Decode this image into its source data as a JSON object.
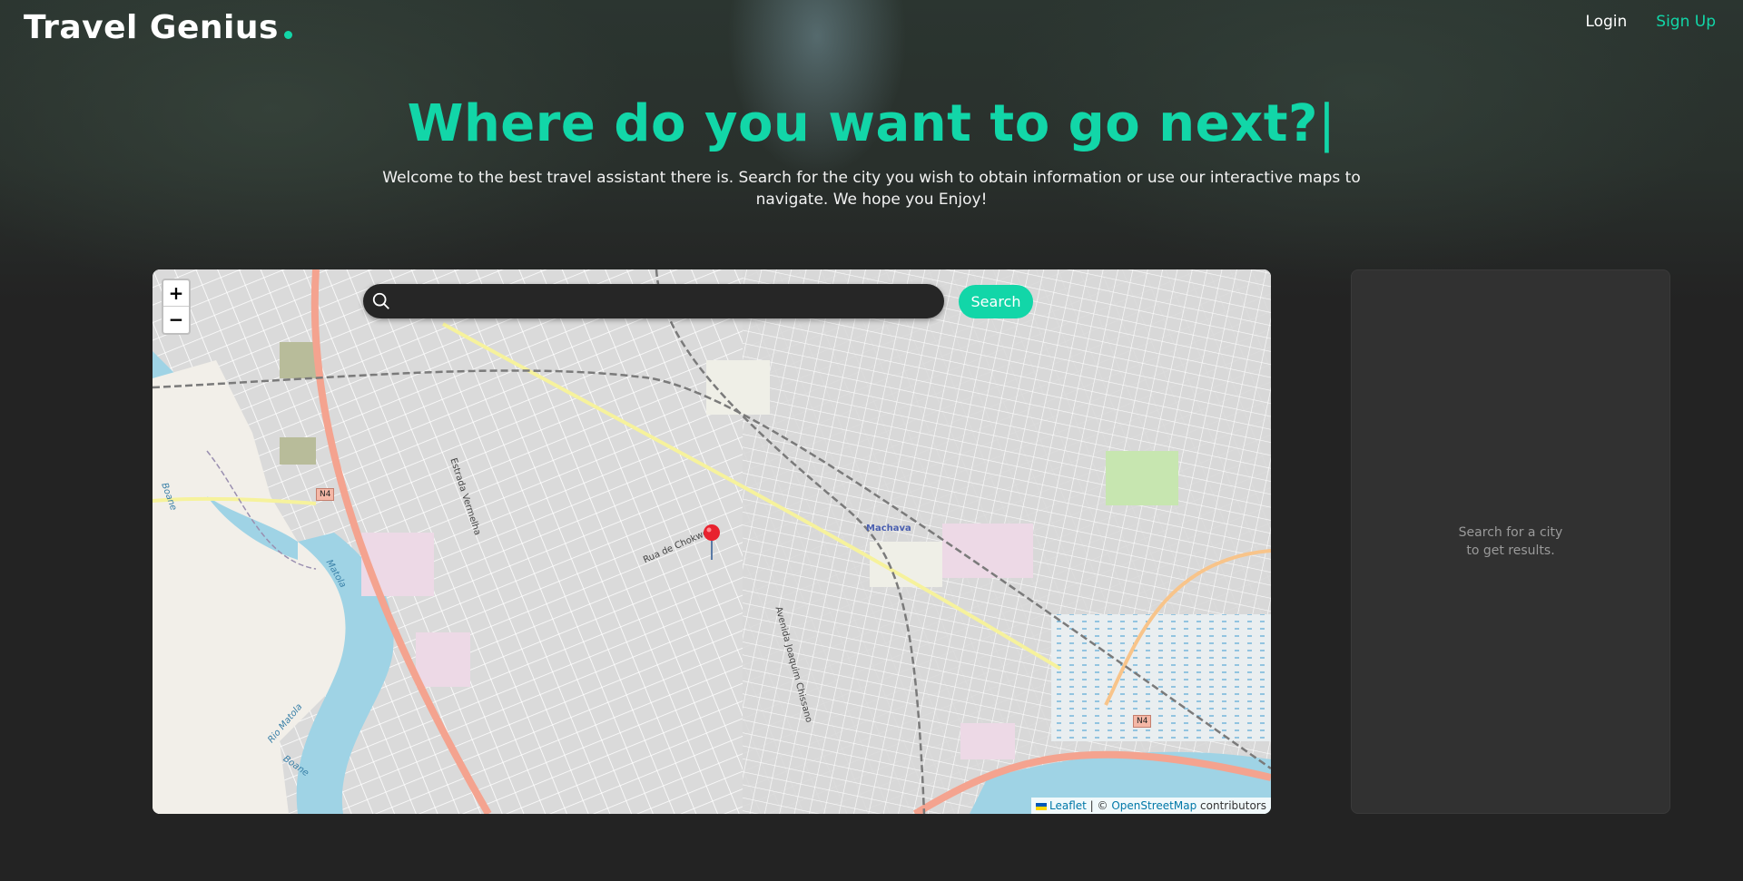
{
  "header": {
    "brand": "Travel Genius",
    "login_label": "Login",
    "signup_label": "Sign Up",
    "accent_color": "#12d6a8"
  },
  "hero": {
    "headline": "Where do you want to go next?",
    "cursor": "|",
    "subtitle": "Welcome to the best travel assistant there is. Search for the city you wish to obtain information or use our interactive maps to navigate. We hope you Enjoy!"
  },
  "map": {
    "zoom_in_label": "+",
    "zoom_out_label": "−",
    "search": {
      "placeholder": "",
      "value": "",
      "button_label": "Search",
      "icon": "search-icon"
    },
    "labels": {
      "street_1": "Rua de Chokwe",
      "street_2": "Estrada Vermelha",
      "street_3": "Avenida Joaquim Chissano",
      "river_1": "Matola",
      "river_2": "Rio Matola",
      "river_3": "Boane",
      "river_4": "Boane",
      "station": "Machava",
      "shield_1": "N4",
      "shield_2": "N4"
    },
    "attribution": {
      "leaflet": "Leaflet",
      "separator": " | © ",
      "osm": "OpenStreetMap",
      "suffix": " contributors"
    }
  },
  "results_panel": {
    "hint": "Search for a city to get results."
  }
}
